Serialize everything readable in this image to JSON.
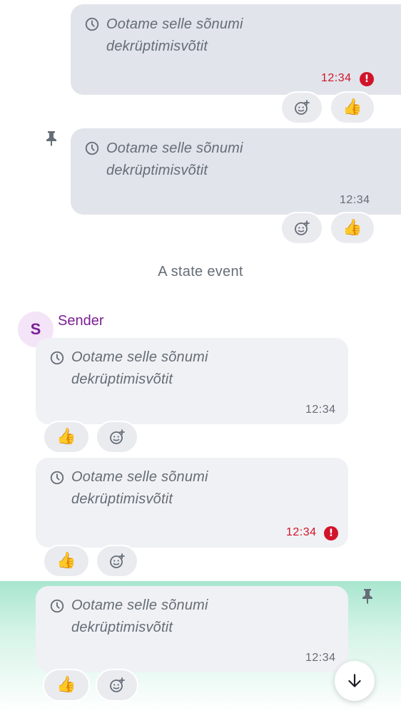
{
  "messages": [
    {
      "text_line1": "Ootame selle sõnumi",
      "text_line2": "dekrüptimisvõtit",
      "time": "12:34",
      "status": "error",
      "direction": "outgoing",
      "pinned": false,
      "reaction": "👍"
    },
    {
      "text_line1": "Ootame selle sõnumi",
      "text_line2": "dekrüptimisvõtit",
      "time": "12:34",
      "status": "sent",
      "direction": "outgoing",
      "pinned": true,
      "reaction": "👍"
    },
    {
      "text_line1": "Ootame selle sõnumi",
      "text_line2": "dekrüptimisvõtit",
      "time": "12:34",
      "status": "sent",
      "direction": "incoming",
      "pinned": false,
      "reaction": "👍"
    },
    {
      "text_line1": "Ootame selle sõnumi",
      "text_line2": "dekrüptimisvõtit",
      "time": "12:34",
      "status": "error",
      "direction": "incoming",
      "pinned": false,
      "reaction": "👍"
    },
    {
      "text_line1": "Ootame selle sõnumi",
      "text_line2": "dekrüptimisvõtit",
      "time": "12:34",
      "status": "sent",
      "direction": "incoming",
      "pinned": true,
      "highlighted": true,
      "reaction": "👍"
    }
  ],
  "state_event": "A state event",
  "sender": {
    "name": "Sender",
    "avatar_initial": "S"
  },
  "icons": {
    "clock": "clock-icon",
    "error": "error-icon",
    "pin": "pin-icon",
    "add_reaction": "add-reaction-icon",
    "scroll_down": "arrow-down-icon",
    "error_glyph": "!"
  },
  "colors": {
    "outgoing_bubble": "#e1e4ea",
    "incoming_bubble": "#f0f1f4",
    "error": "#d1142a",
    "sender_name": "#7b1f94",
    "avatar_bg": "#f3e4f7",
    "highlight": "#a8e6cf"
  }
}
